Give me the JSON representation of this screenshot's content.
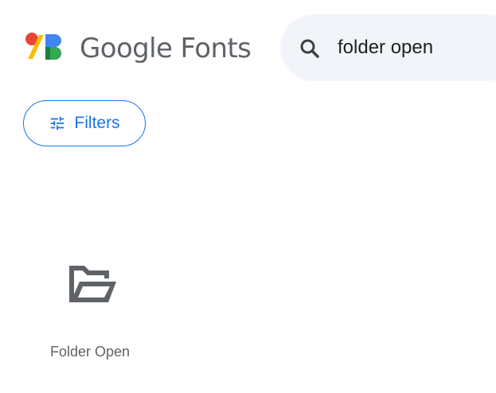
{
  "header": {
    "brand_name": "Google Fonts"
  },
  "search": {
    "value": "folder open"
  },
  "filters": {
    "label": "Filters"
  },
  "results": [
    {
      "label": "Folder Open",
      "icon": "folder-open-icon"
    }
  ],
  "colors": {
    "accent": "#1a73e8",
    "search_background": "#f1f4f9",
    "text_gray": "#5f6368",
    "logo_red": "#ea4335",
    "logo_yellow": "#fbbc04",
    "logo_green": "#34a853",
    "logo_blue": "#4285f4"
  }
}
